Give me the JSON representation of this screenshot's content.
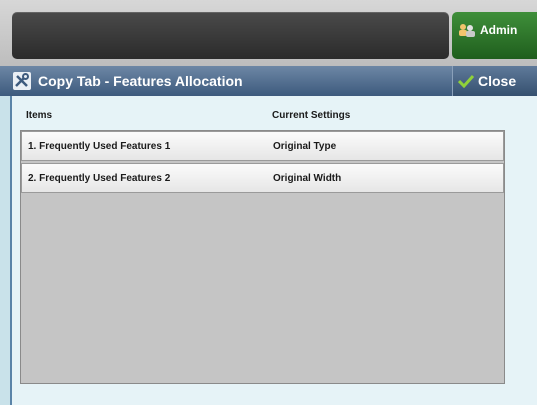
{
  "header": {
    "admin_label": "Admin"
  },
  "title_bar": {
    "title": "Copy Tab - Features Allocation",
    "close_label": "Close"
  },
  "table": {
    "columns": [
      "Items",
      "Current Settings"
    ],
    "rows": [
      {
        "item": "1. Frequently Used Features 1",
        "setting": "Original Type"
      },
      {
        "item": "2. Frequently Used Features 2",
        "setting": "Original Width"
      }
    ]
  },
  "colors": {
    "title_bar": "#4a6689",
    "admin_green": "#2f7a2c",
    "content_bg": "#e6f3f7",
    "table_bg": "#c5c5c5"
  }
}
